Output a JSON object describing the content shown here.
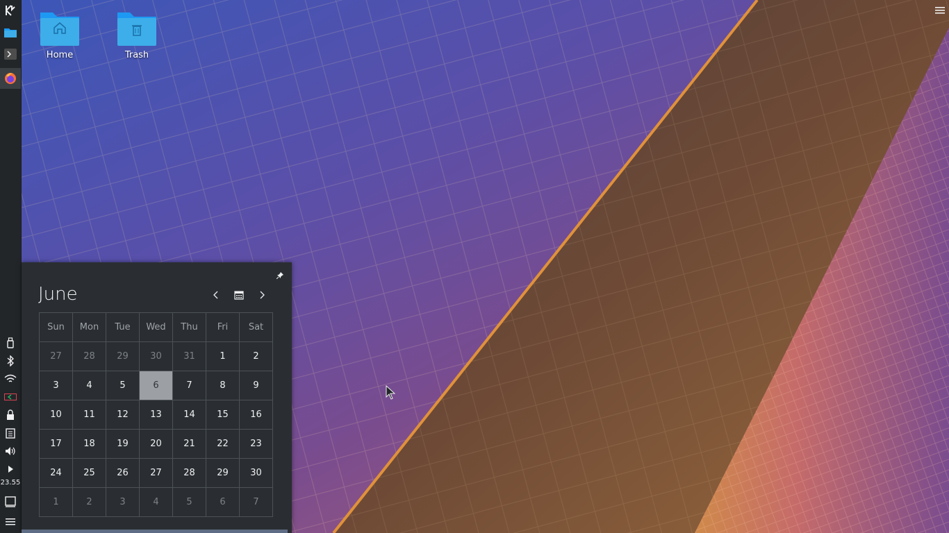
{
  "desktop": {
    "icons": [
      {
        "label": "Home",
        "icon": "folder-home-icon"
      },
      {
        "label": "Trash",
        "icon": "trash-folder-icon"
      }
    ],
    "menu_icon": "hamburger-menu-icon"
  },
  "panel": {
    "launchers": [
      "kde-launcher-icon",
      "file-manager-icon",
      "terminal-icon",
      "firefox-icon"
    ],
    "tray": [
      "usb-device-icon",
      "bluetooth-icon",
      "wifi-icon",
      "battery-icon",
      "lock-icon",
      "clipboard-icon",
      "volume-icon",
      "tray-expand-icon"
    ],
    "clock": "23.55",
    "bottom": [
      "show-desktop-icon",
      "panel-menu-icon"
    ]
  },
  "calendar": {
    "month": "June",
    "weekdays": [
      "Sun",
      "Mon",
      "Tue",
      "Wed",
      "Thu",
      "Fri",
      "Sat"
    ],
    "weeks": [
      [
        {
          "d": "27",
          "dim": true
        },
        {
          "d": "28",
          "dim": true
        },
        {
          "d": "29",
          "dim": true
        },
        {
          "d": "30",
          "dim": true
        },
        {
          "d": "31",
          "dim": true
        },
        {
          "d": "1"
        },
        {
          "d": "2"
        }
      ],
      [
        {
          "d": "3"
        },
        {
          "d": "4"
        },
        {
          "d": "5"
        },
        {
          "d": "6",
          "today": true
        },
        {
          "d": "7"
        },
        {
          "d": "8"
        },
        {
          "d": "9"
        }
      ],
      [
        {
          "d": "10"
        },
        {
          "d": "11"
        },
        {
          "d": "12"
        },
        {
          "d": "13"
        },
        {
          "d": "14"
        },
        {
          "d": "15"
        },
        {
          "d": "16"
        }
      ],
      [
        {
          "d": "17"
        },
        {
          "d": "18"
        },
        {
          "d": "19"
        },
        {
          "d": "20"
        },
        {
          "d": "21"
        },
        {
          "d": "22"
        },
        {
          "d": "23"
        }
      ],
      [
        {
          "d": "24"
        },
        {
          "d": "25"
        },
        {
          "d": "26"
        },
        {
          "d": "27"
        },
        {
          "d": "28"
        },
        {
          "d": "29"
        },
        {
          "d": "30"
        }
      ],
      [
        {
          "d": "1",
          "dim": true
        },
        {
          "d": "2",
          "dim": true
        },
        {
          "d": "3",
          "dim": true
        },
        {
          "d": "4",
          "dim": true
        },
        {
          "d": "5",
          "dim": true
        },
        {
          "d": "6",
          "dim": true
        },
        {
          "d": "7",
          "dim": true
        }
      ]
    ]
  },
  "colors": {
    "panel_bg": "#232629",
    "popup_bg": "#2a2e32",
    "today_bg": "#9c9fa3",
    "folder_blue": "#3daee9"
  }
}
